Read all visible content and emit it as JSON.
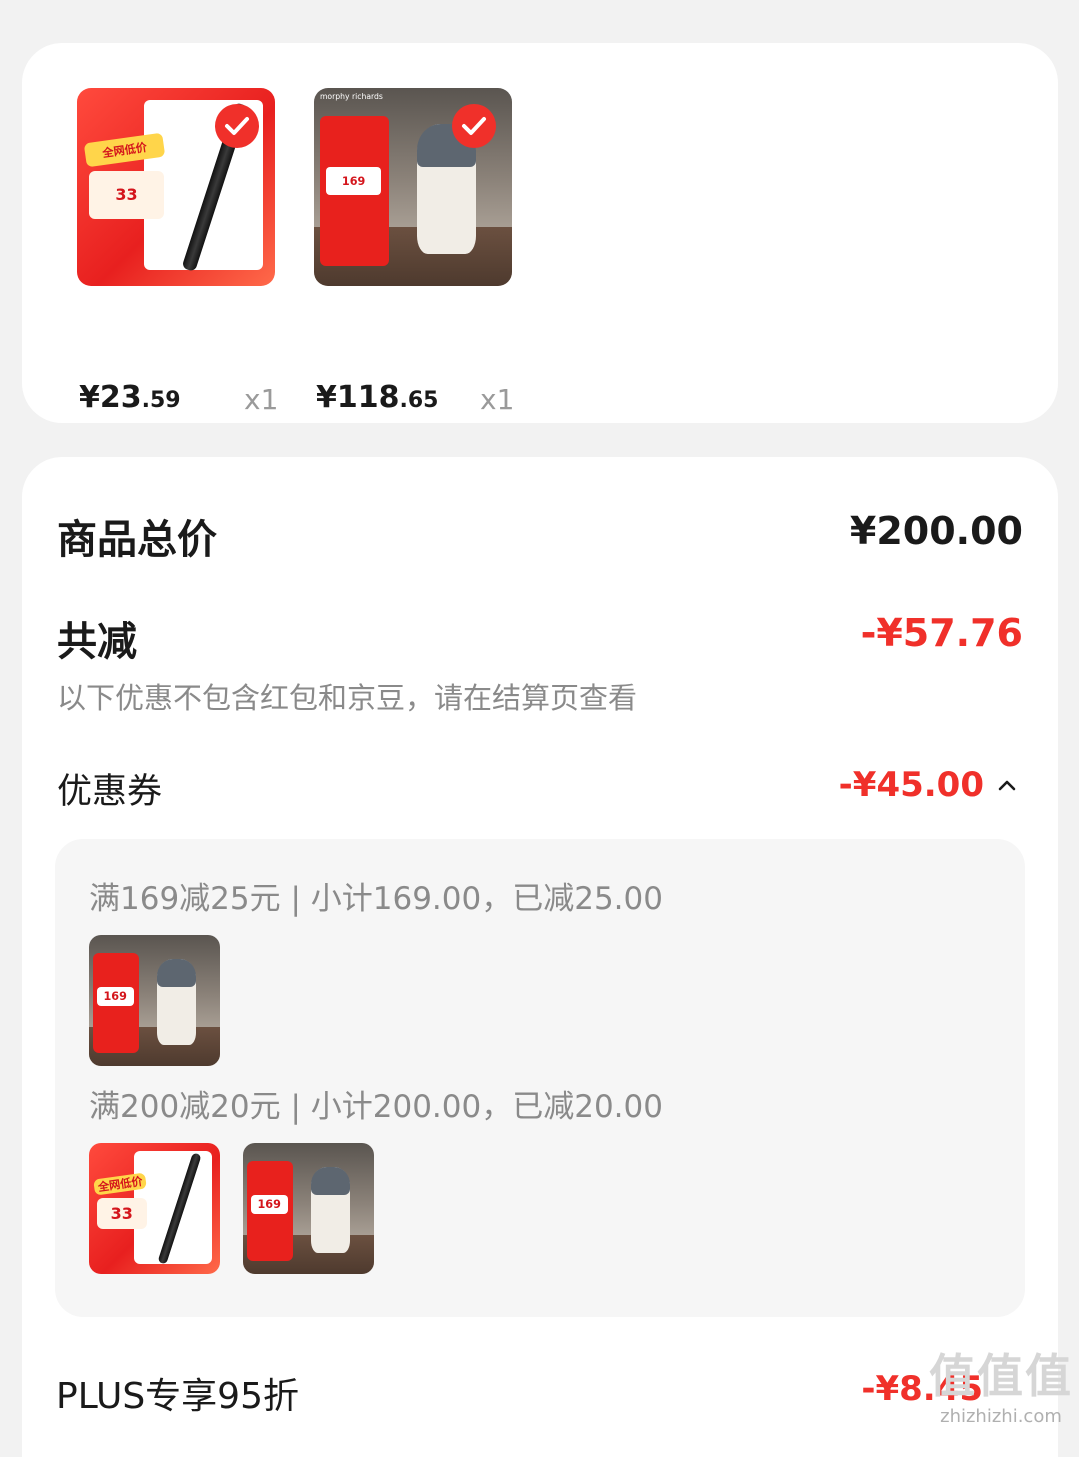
{
  "cart_items": [
    {
      "image": "pen-product-image",
      "price_int": "¥23",
      "price_dec": ".59",
      "qty": "x1",
      "selected": true
    },
    {
      "image": "kettle-product-image",
      "price_int": "¥118",
      "price_dec": ".65",
      "qty": "x1",
      "selected": true
    }
  ],
  "summary": {
    "total_label": "商品总价",
    "total_value": "¥200.00",
    "discount_label": "共减",
    "discount_value": "-¥57.76",
    "discount_note": "以下优惠不包含红包和京豆，请在结算页查看",
    "coupon_label": "优惠券",
    "coupon_value": "-¥45.00",
    "coupon_rules": [
      {
        "text": "满169减25元 | 小计169.00，已减25.00",
        "items": [
          "kettle-product-image"
        ]
      },
      {
        "text": "满200减20元 | 小计200.00，已减20.00",
        "items": [
          "pen-product-image",
          "kettle-product-image"
        ]
      }
    ],
    "plus_label": "PLUS专享95折",
    "plus_value": "-¥8.45"
  },
  "thumb_text": {
    "pen_tag": "全网低价",
    "pen_price": "33",
    "kettle_brand": "morphy richards",
    "kettle_price": "169"
  },
  "watermark": {
    "logo": "值值值",
    "url": "zhizhizhi.com"
  },
  "colors": {
    "accent_red": "#f0302a",
    "background": "#f2f2f2",
    "card": "#ffffff"
  }
}
